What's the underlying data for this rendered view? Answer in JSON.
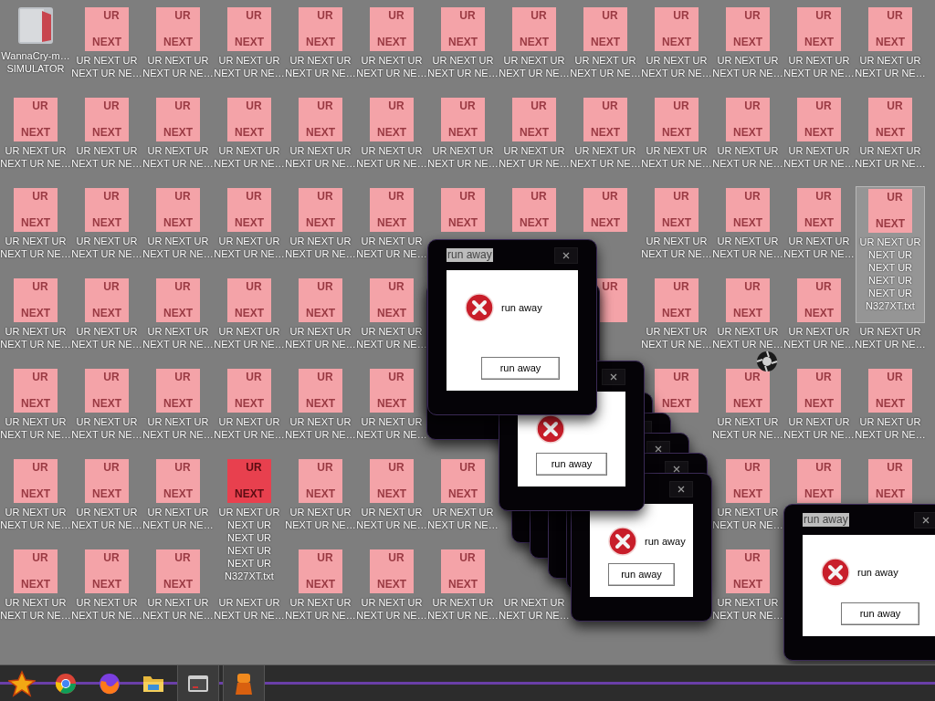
{
  "desktop": {
    "rows": [
      {
        "icons": [
          {
            "kind": "app",
            "label": "WannaCry-m… SIMULATOR"
          },
          {
            "kind": "file",
            "art": {
              "top": "UR",
              "bottom": "NEXT"
            },
            "label": "UR NEXT UR NEXT UR NE…",
            "selected": false
          },
          {
            "kind": "file",
            "art": {
              "top": "UR",
              "bottom": "NEXT"
            },
            "label": "UR NEXT UR NEXT UR NE…",
            "selected": false
          },
          {
            "kind": "file",
            "art": {
              "top": "UR",
              "bottom": "NEXT"
            },
            "label": "UR NEXT UR NEXT UR NE…",
            "selected": false
          },
          {
            "kind": "file",
            "art": {
              "top": "UR",
              "bottom": "NEXT"
            },
            "label": "UR NEXT UR NEXT UR NE…",
            "selected": false
          },
          {
            "kind": "file",
            "art": {
              "top": "UR",
              "bottom": "NEXT"
            },
            "label": "UR NEXT UR NEXT UR NE…",
            "selected": false
          },
          {
            "kind": "file",
            "art": {
              "top": "UR",
              "bottom": "NEXT"
            },
            "label": "UR NEXT UR NEXT UR NE…",
            "selected": false
          },
          {
            "kind": "file",
            "art": {
              "top": "UR",
              "bottom": "NEXT"
            },
            "label": "UR NEXT UR NEXT UR NE…",
            "selected": false
          },
          {
            "kind": "file",
            "art": {
              "top": "UR",
              "bottom": "NEXT"
            },
            "label": "UR NEXT UR NEXT UR NE…",
            "selected": false
          },
          {
            "kind": "file",
            "art": {
              "top": "UR",
              "bottom": "NEXT"
            },
            "label": "UR NEXT UR NEXT UR NE…",
            "selected": false
          },
          {
            "kind": "file",
            "art": {
              "top": "UR",
              "bottom": "NEXT"
            },
            "label": "UR NEXT UR NEXT UR NE…",
            "selected": false
          },
          {
            "kind": "file",
            "art": {
              "top": "UR",
              "bottom": "NEXT"
            },
            "label": "UR NEXT UR NEXT UR NE…",
            "selected": false
          },
          {
            "kind": "file",
            "art": {
              "top": "UR",
              "bottom": "NEXT"
            },
            "label": "UR NEXT UR NEXT UR NE…",
            "selected": false
          }
        ]
      },
      {
        "icons": [
          {
            "kind": "file",
            "art": {
              "top": "UR",
              "bottom": "NEXT"
            },
            "label": "UR NEXT UR NEXT UR NE…",
            "selected": false
          },
          {
            "kind": "file",
            "art": {
              "top": "UR",
              "bottom": "NEXT"
            },
            "label": "UR NEXT UR NEXT UR NE…",
            "selected": false
          },
          {
            "kind": "file",
            "art": {
              "top": "UR",
              "bottom": "NEXT"
            },
            "label": "UR NEXT UR NEXT UR NE…",
            "selected": false
          },
          {
            "kind": "file",
            "art": {
              "top": "UR",
              "bottom": "NEXT"
            },
            "label": "UR NEXT UR NEXT UR NE…",
            "selected": false
          },
          {
            "kind": "file",
            "art": {
              "top": "UR",
              "bottom": "NEXT"
            },
            "label": "UR NEXT UR NEXT UR NE…",
            "selected": false
          },
          {
            "kind": "file",
            "art": {
              "top": "UR",
              "bottom": "NEXT"
            },
            "label": "UR NEXT UR NEXT UR NE…",
            "selected": false
          },
          {
            "kind": "file",
            "art": {
              "top": "UR",
              "bottom": "NEXT"
            },
            "label": "UR NEXT UR NEXT UR NE…",
            "selected": false
          },
          {
            "kind": "file",
            "art": {
              "top": "UR",
              "bottom": "NEXT"
            },
            "label": "UR NEXT UR NEXT UR NE…",
            "selected": false
          },
          {
            "kind": "file",
            "art": {
              "top": "UR",
              "bottom": "NEXT"
            },
            "label": "UR NEXT UR NEXT UR NE…",
            "selected": false
          },
          {
            "kind": "file",
            "art": {
              "top": "UR",
              "bottom": "NEXT"
            },
            "label": "UR NEXT UR NEXT UR NE…",
            "selected": false
          },
          {
            "kind": "file",
            "art": {
              "top": "UR",
              "bottom": "NEXT"
            },
            "label": "UR NEXT UR NEXT UR NE…",
            "selected": false
          },
          {
            "kind": "file",
            "art": {
              "top": "UR",
              "bottom": "NEXT"
            },
            "label": "UR NEXT UR NEXT UR NE…",
            "selected": false
          },
          {
            "kind": "file",
            "art": {
              "top": "UR",
              "bottom": "NEXT"
            },
            "label": "UR NEXT UR NEXT UR NE…",
            "selected": false
          }
        ]
      },
      {
        "icons": [
          {
            "kind": "file",
            "art": {
              "top": "UR",
              "bottom": "NEXT"
            },
            "label": "UR NEXT UR NEXT UR NE…",
            "selected": false
          },
          {
            "kind": "file",
            "art": {
              "top": "UR",
              "bottom": "NEXT"
            },
            "label": "UR NEXT UR NEXT UR NE…",
            "selected": false
          },
          {
            "kind": "file",
            "art": {
              "top": "UR",
              "bottom": "NEXT"
            },
            "label": "UR NEXT UR NEXT UR NE…",
            "selected": false
          },
          {
            "kind": "file",
            "art": {
              "top": "UR",
              "bottom": "NEXT"
            },
            "label": "UR NEXT UR NEXT UR NE…",
            "selected": false
          },
          {
            "kind": "file",
            "art": {
              "top": "UR",
              "bottom": "NEXT"
            },
            "label": "UR NEXT UR NEXT UR NE…",
            "selected": false
          },
          {
            "kind": "file",
            "art": {
              "top": "UR",
              "bottom": "NEXT"
            },
            "label": "UR NEXT UR NEXT UR NE…",
            "selected": false
          },
          {
            "kind": "file",
            "art": {
              "top": "UR",
              "bottom": "NEXT"
            },
            "selected": false
          },
          {
            "kind": "file",
            "art": {
              "top": "UR",
              "bottom": "NEXT"
            },
            "selected": false
          },
          {
            "kind": "file",
            "art": {
              "top": "UR",
              "bottom": "NEXT"
            },
            "selected": false
          },
          {
            "kind": "file",
            "art": {
              "top": "UR",
              "bottom": "NEXT"
            },
            "label": "UR NEXT UR NEXT UR NE…",
            "selected": false
          },
          {
            "kind": "file",
            "art": {
              "top": "UR",
              "bottom": "NEXT"
            },
            "label": "UR NEXT UR NEXT UR NE…",
            "selected": false
          },
          {
            "kind": "file",
            "art": {
              "top": "UR",
              "bottom": "NEXT"
            },
            "label": "UR NEXT UR NEXT UR NE…",
            "selected": false
          },
          {
            "kind": "file-open",
            "art": {
              "top": "UR",
              "bottom": "NEXT"
            },
            "label": "UR NEXT UR NEXT UR NEXT UR NEXT UR NEXT UR N327XT.txt",
            "selected": false
          }
        ]
      },
      {
        "icons": [
          {
            "kind": "file",
            "art": {
              "top": "UR",
              "bottom": "NEXT"
            },
            "label": "UR NEXT UR NEXT UR NE…",
            "selected": false
          },
          {
            "kind": "file",
            "art": {
              "top": "UR",
              "bottom": "NEXT"
            },
            "label": "UR NEXT UR NEXT UR NE…",
            "selected": false
          },
          {
            "kind": "file",
            "art": {
              "top": "UR",
              "bottom": "NEXT"
            },
            "label": "UR NEXT UR NEXT UR NE…",
            "selected": false
          },
          {
            "kind": "file",
            "art": {
              "top": "UR",
              "bottom": "NEXT"
            },
            "label": "UR NEXT UR NEXT UR NE…",
            "selected": false
          },
          {
            "kind": "file",
            "art": {
              "top": "UR",
              "bottom": "NEXT"
            },
            "label": "UR NEXT UR NEXT UR NE…",
            "selected": false
          },
          {
            "kind": "file",
            "art": {
              "top": "UR",
              "bottom": "NEXT"
            },
            "label": "UR NEXT UR NEXT UR NE…",
            "selected": false
          },
          {
            "kind": "covered"
          },
          {
            "kind": "covered"
          },
          {
            "kind": "file",
            "art": {
              "top": "UR"
            },
            "selected": false
          },
          {
            "kind": "file",
            "art": {
              "top": "UR",
              "bottom": "NEXT"
            },
            "label": "UR NEXT UR NEXT UR NE…",
            "selected": false
          },
          {
            "kind": "file",
            "art": {
              "top": "UR",
              "bottom": "NEXT"
            },
            "label": "UR NEXT UR NEXT UR NE…",
            "selected": false
          },
          {
            "kind": "file",
            "art": {
              "top": "UR",
              "bottom": "NEXT"
            },
            "label": "UR NEXT UR NEXT UR NE…",
            "selected": false
          },
          {
            "kind": "file",
            "label": "UR NEXT UR NEXT UR NE…",
            "selected": false
          }
        ]
      },
      {
        "icons": [
          {
            "kind": "file",
            "art": {
              "top": "UR",
              "bottom": "NEXT"
            },
            "label": "UR NEXT UR NEXT UR NE…",
            "selected": false
          },
          {
            "kind": "file",
            "art": {
              "top": "UR",
              "bottom": "NEXT"
            },
            "label": "UR NEXT UR NEXT UR NE…",
            "selected": false
          },
          {
            "kind": "file",
            "art": {
              "top": "UR",
              "bottom": "NEXT"
            },
            "label": "UR NEXT UR NEXT UR NE…",
            "selected": false
          },
          {
            "kind": "file",
            "art": {
              "top": "UR",
              "bottom": "NEXT"
            },
            "label": "UR NEXT UR NEXT UR NE…",
            "selected": false
          },
          {
            "kind": "file",
            "art": {
              "top": "UR",
              "bottom": "NEXT"
            },
            "label": "UR NEXT UR NEXT UR NE…",
            "selected": false
          },
          {
            "kind": "file",
            "art": {
              "top": "UR",
              "bottom": "NEXT"
            },
            "label": "UR NEXT UR NEXT UR NE…",
            "selected": false
          },
          {
            "kind": "covered"
          },
          {
            "kind": "covered"
          },
          {
            "kind": "covered"
          },
          {
            "kind": "file",
            "art": {
              "top": "UR",
              "bottom": "NEXT"
            },
            "selected": false
          },
          {
            "kind": "file",
            "art": {
              "top": "UR",
              "bottom": "NEXT"
            },
            "label": "UR NEXT UR NEXT UR NE…",
            "selected": false
          },
          {
            "kind": "file",
            "art": {
              "top": "UR",
              "bottom": "NEXT"
            },
            "label": "UR NEXT UR NEXT UR NE…",
            "selected": false
          },
          {
            "kind": "file",
            "art": {
              "top": "UR",
              "bottom": "NEXT"
            },
            "label": "UR NEXT UR NEXT UR NE…",
            "selected": false
          }
        ]
      },
      {
        "icons": [
          {
            "kind": "file",
            "art": {
              "top": "UR",
              "bottom": "NEXT"
            },
            "label": "UR NEXT UR NEXT UR NE…",
            "selected": false
          },
          {
            "kind": "file",
            "art": {
              "top": "UR",
              "bottom": "NEXT"
            },
            "label": "UR NEXT UR NEXT UR NE…",
            "selected": false
          },
          {
            "kind": "file",
            "art": {
              "top": "UR",
              "bottom": "NEXT"
            },
            "label": "UR NEXT UR NEXT UR NE…",
            "selected": false
          },
          {
            "kind": "file-open",
            "art": {
              "top": "UR",
              "bottom": "NEXT"
            },
            "label": "UR NEXT UR NEXT UR NEXT UR NEXT UR NEXT UR N327XT.txt",
            "selected": true
          },
          {
            "kind": "file",
            "art": {
              "top": "UR",
              "bottom": "NEXT"
            },
            "label": "UR NEXT UR NEXT UR NE…",
            "selected": false
          },
          {
            "kind": "file",
            "art": {
              "top": "UR",
              "bottom": "NEXT"
            },
            "label": "UR NEXT UR NEXT UR NE…",
            "selected": false
          },
          {
            "kind": "file",
            "art": {
              "top": "UR",
              "bottom": "NEXT"
            },
            "label": "UR NEXT UR NEXT UR NE…",
            "selected": false
          },
          {
            "kind": "covered"
          },
          {
            "kind": "covered"
          },
          {
            "kind": "covered"
          },
          {
            "kind": "file",
            "art": {
              "top": "UR",
              "bottom": "NEXT"
            },
            "label": "UR NEXT UR NEXT UR NE…",
            "selected": false
          },
          {
            "kind": "file",
            "art": {
              "top": "UR",
              "bottom": "NEXT"
            },
            "selected": false
          },
          {
            "kind": "file",
            "art": {
              "top": "UR",
              "bottom": "NEXT"
            },
            "selected": false
          }
        ]
      },
      {
        "icons": [
          {
            "kind": "file",
            "art": {
              "top": "UR",
              "bottom": "NEXT"
            },
            "label": "UR NEXT UR NEXT UR NE…",
            "selected": false
          },
          {
            "kind": "file",
            "art": {
              "top": "UR",
              "bottom": "NEXT"
            },
            "label": "UR NEXT UR NEXT UR NE…",
            "selected": false
          },
          {
            "kind": "file",
            "art": {
              "top": "UR",
              "bottom": "NEXT"
            },
            "label": "UR NEXT UR NEXT UR NE…",
            "selected": false
          },
          {
            "kind": "file",
            "label": "UR NEXT UR NEXT UR NE…",
            "selected": false
          },
          {
            "kind": "file",
            "art": {
              "top": "UR",
              "bottom": "NEXT"
            },
            "label": "UR NEXT UR NEXT UR NE…",
            "selected": false
          },
          {
            "kind": "file",
            "art": {
              "top": "UR",
              "bottom": "NEXT"
            },
            "label": "UR NEXT UR NEXT UR NE…",
            "selected": false
          },
          {
            "kind": "file",
            "art": {
              "top": "UR",
              "bottom": "NEXT"
            },
            "label": "UR NEXT UR NEXT UR NE…",
            "selected": false
          },
          {
            "kind": "file",
            "label": "UR NEXT UR NEXT UR NE…",
            "selected": false
          },
          {
            "kind": "covered"
          },
          {
            "kind": "covered"
          },
          {
            "kind": "file",
            "art": {
              "top": "UR",
              "bottom": "NEXT"
            },
            "label": "UR NEXT UR NEXT UR NE…",
            "selected": false
          },
          {
            "kind": "covered"
          },
          {
            "kind": "covered"
          }
        ]
      }
    ]
  },
  "windows": [
    {
      "kind": "frame"
    },
    {
      "kind": "frame"
    },
    {
      "kind": "frame"
    },
    {
      "kind": "frame"
    },
    {
      "kind": "frame"
    },
    {
      "kind": "dialog",
      "message": "run away",
      "button": "run away"
    },
    {
      "kind": "dialog",
      "button": "run away"
    },
    {
      "kind": "dialog",
      "title": "run away",
      "message": "run away",
      "button": "run away"
    },
    {
      "kind": "dialog",
      "title": "run away",
      "message": "run away",
      "button": "run away"
    }
  ],
  "taskbar": {
    "apps": [
      {
        "kind": "star"
      },
      {
        "kind": "browser"
      },
      {
        "kind": "fox"
      },
      {
        "kind": "folder"
      },
      {
        "kind": "window",
        "selected": true
      },
      {
        "kind": "figure",
        "selected": true
      }
    ]
  }
}
